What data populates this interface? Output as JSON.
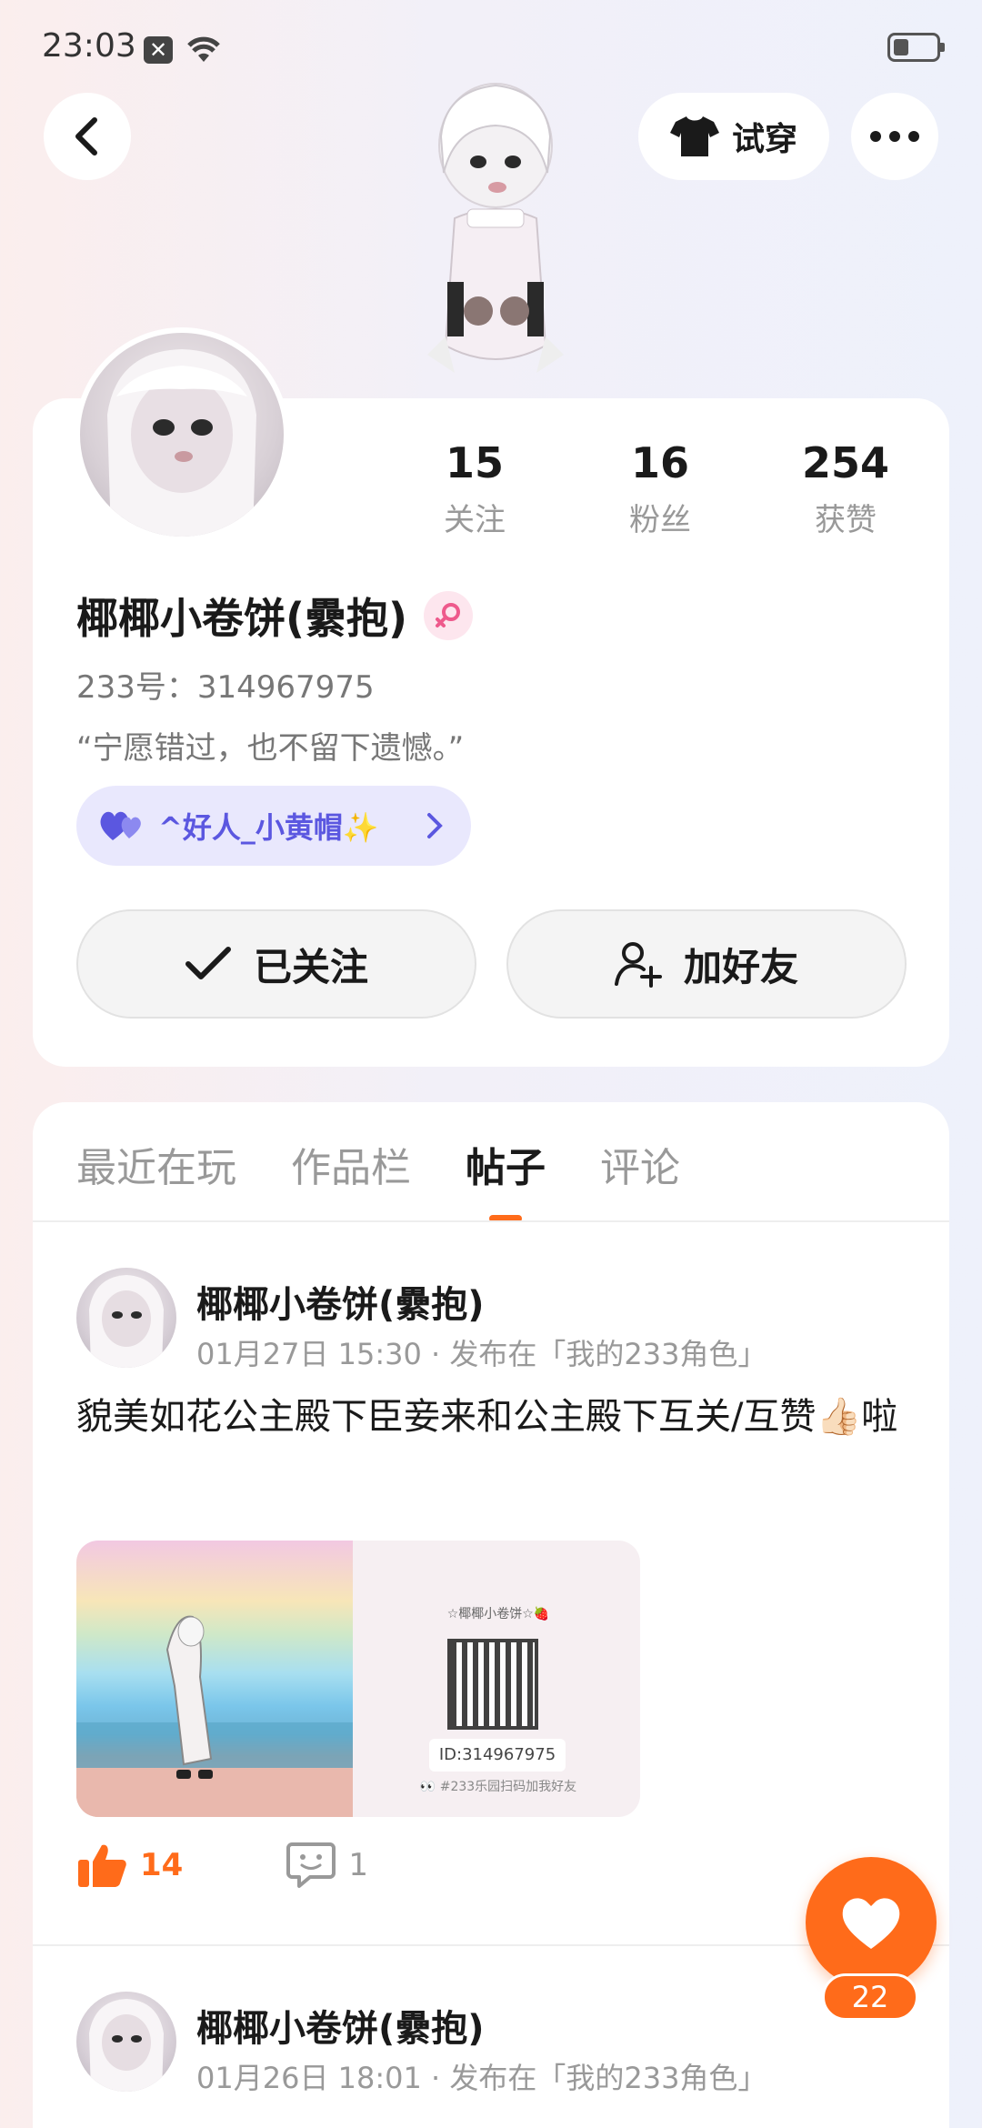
{
  "status_bar": {
    "time": "23:03"
  },
  "top_bar": {
    "tryon_label": "试穿"
  },
  "profile": {
    "stats": [
      {
        "value": "15",
        "label": "关注"
      },
      {
        "value": "16",
        "label": "粉丝"
      },
      {
        "value": "254",
        "label": "获赞"
      }
    ],
    "name": "椰椰小卷饼(纍抱)",
    "id_text": "233号：314967975",
    "bio": "“宁愿错过，也不留下遗憾。”",
    "relation_label": "^好人_小黄帽✨",
    "followed_label": "已关注",
    "add_friend_label": "加好友"
  },
  "tabs": [
    {
      "label": "最近在玩",
      "active": false
    },
    {
      "label": "作品栏",
      "active": false
    },
    {
      "label": "帖子",
      "active": true
    },
    {
      "label": "评论",
      "active": false
    }
  ],
  "posts": [
    {
      "author": "椰椰小卷饼(纍抱)",
      "meta": "01月27日 15:30 · 发布在「我的233角色」",
      "text": "貌美如花公主殿下臣妾来和公主殿下互关/互赞👍🏻啦",
      "image_qr_header": "☆椰椰小卷饼☆🍓",
      "image_qr_id": "ID:314967975",
      "image_qr_caption": "👀 #233乐园扫码加我好友",
      "likes": "14",
      "comments": "1"
    },
    {
      "author": "椰椰小卷饼(纍抱)",
      "meta": "01月26日 18:01 · 发布在「我的233角色」"
    }
  ],
  "fab": {
    "count": "22"
  },
  "colors": {
    "accent": "#ff6b1a",
    "relation": "#5b57e0"
  }
}
